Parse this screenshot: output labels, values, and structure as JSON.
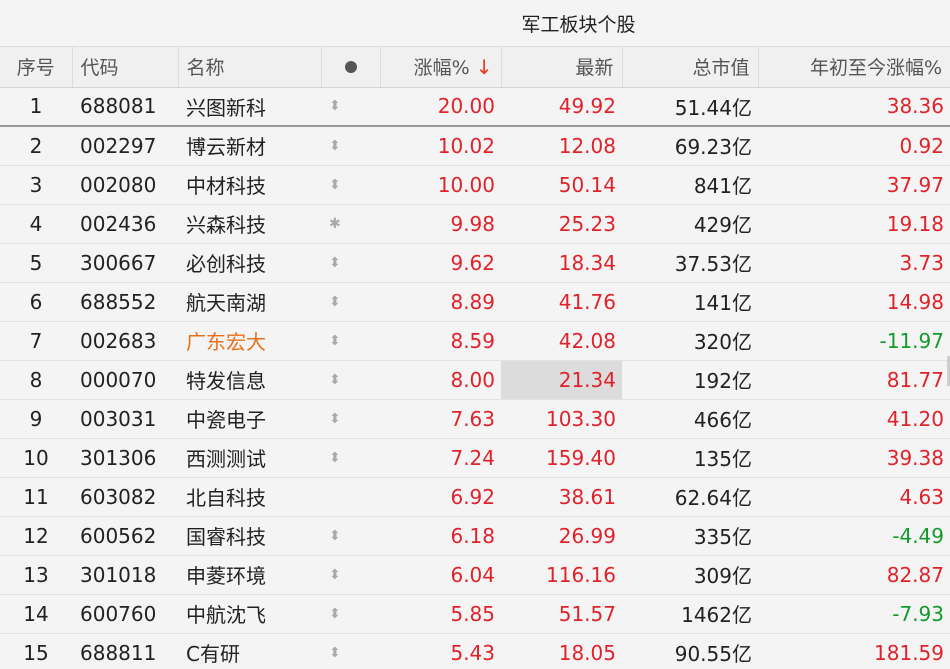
{
  "header": {
    "title": "军工板块个股"
  },
  "columns": {
    "idx": "序号",
    "code": "代码",
    "name": "名称",
    "pct": "涨幅%",
    "sort_arrow": "↓",
    "price": "最新",
    "mcap": "总市值",
    "ytd": "年初至今涨幅%"
  },
  "rows": [
    {
      "idx": "1",
      "code": "688081",
      "name": "兴图新科",
      "icon": "⬍",
      "pct": "20.00",
      "price": "49.92",
      "mcap": "51.44亿",
      "ytd": "38.36",
      "ytd_dir": "pos"
    },
    {
      "idx": "2",
      "code": "002297",
      "name": "博云新材",
      "icon": "⬍",
      "pct": "10.02",
      "price": "12.08",
      "mcap": "69.23亿",
      "ytd": "0.92",
      "ytd_dir": "pos"
    },
    {
      "idx": "3",
      "code": "002080",
      "name": "中材科技",
      "icon": "⬍",
      "pct": "10.00",
      "price": "50.14",
      "mcap": "841亿",
      "ytd": "37.97",
      "ytd_dir": "pos"
    },
    {
      "idx": "4",
      "code": "002436",
      "name": "兴森科技",
      "icon": "✱",
      "pct": "9.98",
      "price": "25.23",
      "mcap": "429亿",
      "ytd": "19.18",
      "ytd_dir": "pos"
    },
    {
      "idx": "5",
      "code": "300667",
      "name": "必创科技",
      "icon": "⬍",
      "pct": "9.62",
      "price": "18.34",
      "mcap": "37.53亿",
      "ytd": "3.73",
      "ytd_dir": "pos"
    },
    {
      "idx": "6",
      "code": "688552",
      "name": "航天南湖",
      "icon": "⬍",
      "pct": "8.89",
      "price": "41.76",
      "mcap": "141亿",
      "ytd": "14.98",
      "ytd_dir": "pos"
    },
    {
      "idx": "7",
      "code": "002683",
      "name": "广东宏大",
      "icon": "⬍",
      "pct": "8.59",
      "price": "42.08",
      "mcap": "320亿",
      "ytd": "-11.97",
      "ytd_dir": "neg",
      "highlight": true
    },
    {
      "idx": "8",
      "code": "000070",
      "name": "特发信息",
      "icon": "⬍",
      "pct": "8.00",
      "price": "21.34",
      "mcap": "192亿",
      "ytd": "81.77",
      "ytd_dir": "pos",
      "price_selected": true
    },
    {
      "idx": "9",
      "code": "003031",
      "name": "中瓷电子",
      "icon": "⬍",
      "pct": "7.63",
      "price": "103.30",
      "mcap": "466亿",
      "ytd": "41.20",
      "ytd_dir": "pos"
    },
    {
      "idx": "10",
      "code": "301306",
      "name": "西测测试",
      "icon": "⬍",
      "pct": "7.24",
      "price": "159.40",
      "mcap": "135亿",
      "ytd": "39.38",
      "ytd_dir": "pos"
    },
    {
      "idx": "11",
      "code": "603082",
      "name": "北自科技",
      "icon": "",
      "pct": "6.92",
      "price": "38.61",
      "mcap": "62.64亿",
      "ytd": "4.63",
      "ytd_dir": "pos"
    },
    {
      "idx": "12",
      "code": "600562",
      "name": "国睿科技",
      "icon": "⬍",
      "pct": "6.18",
      "price": "26.99",
      "mcap": "335亿",
      "ytd": "-4.49",
      "ytd_dir": "neg"
    },
    {
      "idx": "13",
      "code": "301018",
      "name": "申菱环境",
      "icon": "⬍",
      "pct": "6.04",
      "price": "116.16",
      "mcap": "309亿",
      "ytd": "82.87",
      "ytd_dir": "pos"
    },
    {
      "idx": "14",
      "code": "600760",
      "name": "中航沈飞",
      "icon": "⬍",
      "pct": "5.85",
      "price": "51.57",
      "mcap": "1462亿",
      "ytd": "-7.93",
      "ytd_dir": "neg"
    },
    {
      "idx": "15",
      "code": "688811",
      "name": "C有研",
      "icon": "⬍",
      "pct": "5.43",
      "price": "18.05",
      "mcap": "90.55亿",
      "ytd": "181.59",
      "ytd_dir": "pos"
    }
  ],
  "colors": {
    "up": "#e0222b",
    "down": "#139a2b",
    "highlight_name": "#e8701a"
  }
}
